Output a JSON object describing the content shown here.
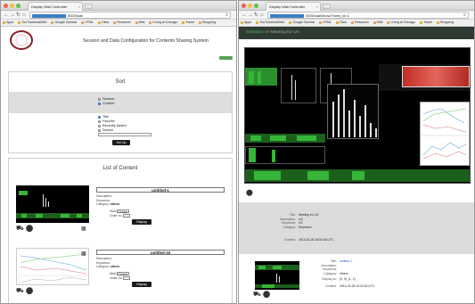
{
  "left_window": {
    "tab_title": "Display Wall Controller",
    "url": ":3000/wall",
    "bookmarks": [
      "Apps",
      "YouTubeleadWeb",
      "Google Scholar",
      "HTML",
      "Cites",
      "Research",
      "Wiki",
      "Living at Chicago",
      "Travel",
      "Shopping"
    ],
    "app_title": "Session and Data Configuration for Contents Sharing System",
    "sort": {
      "heading": "Sort",
      "mode_options": [
        "Session",
        "Content"
      ],
      "sort_options": [
        "Title",
        "Favorite",
        "Recently Added",
        "Search"
      ],
      "button": "Set Up"
    },
    "list": {
      "heading": "List of Content",
      "items": [
        {
          "title": "untitled-1",
          "description_label": "Description:",
          "keywords_label": "Keywords:",
          "category_label": "Category:",
          "category": "others",
          "wall_label": "Wall:",
          "wall_value": "Cluster",
          "order_label": "Order no:",
          "display_button": "Display"
        },
        {
          "title": "untitled-15",
          "description_label": "Description:",
          "keywords_label": "Keywords:",
          "category_label": "Category:",
          "category": "others",
          "wall_label": "Wall:",
          "wall_value": "Cluster",
          "order_label": "Order no:",
          "display_button": "Display"
        }
      ]
    }
  },
  "right_window": {
    "tab_title": "Display Wall Controller",
    "url": ":3000/wall/show/?/sesi_id=1",
    "bookmarks": [
      "Apps",
      "YouTubeleadWeb",
      "Google Scholar",
      "HTML",
      "Cites",
      "Research",
      "Wiki",
      "Living at Chicago",
      "Travel",
      "Shopping"
    ],
    "breadcrumb": "Sessions",
    "breadcrumb_sep": ">>",
    "session_title": "Meeting for UX",
    "session_info": {
      "title_label": "Title:",
      "title": "Meeting for UX",
      "description_label": "Description:",
      "description": "UX",
      "keywords_label": "Keywords:",
      "keywords": "UX",
      "category_label": "Category:",
      "category": "Research",
      "created_label": "Created:",
      "created": "2014-03-28 18:05:46 UTC"
    },
    "content": {
      "title_label": "Title:",
      "title": "untitled-1",
      "description_label": "Description:",
      "keywords_label": "Keywords:",
      "category_label": "Category:",
      "category": "others",
      "display_on_label": "Display on:",
      "display_on": "(0, 0), (1, 1)",
      "created_label": "Created:",
      "created": "2014-03-28 13:20:02 UTC"
    }
  },
  "colors": {
    "accent_green": "#37b538",
    "header_dark": "#2f3a33",
    "link_blue": "#2a5db0",
    "heatmap_red": "#c22d24"
  }
}
